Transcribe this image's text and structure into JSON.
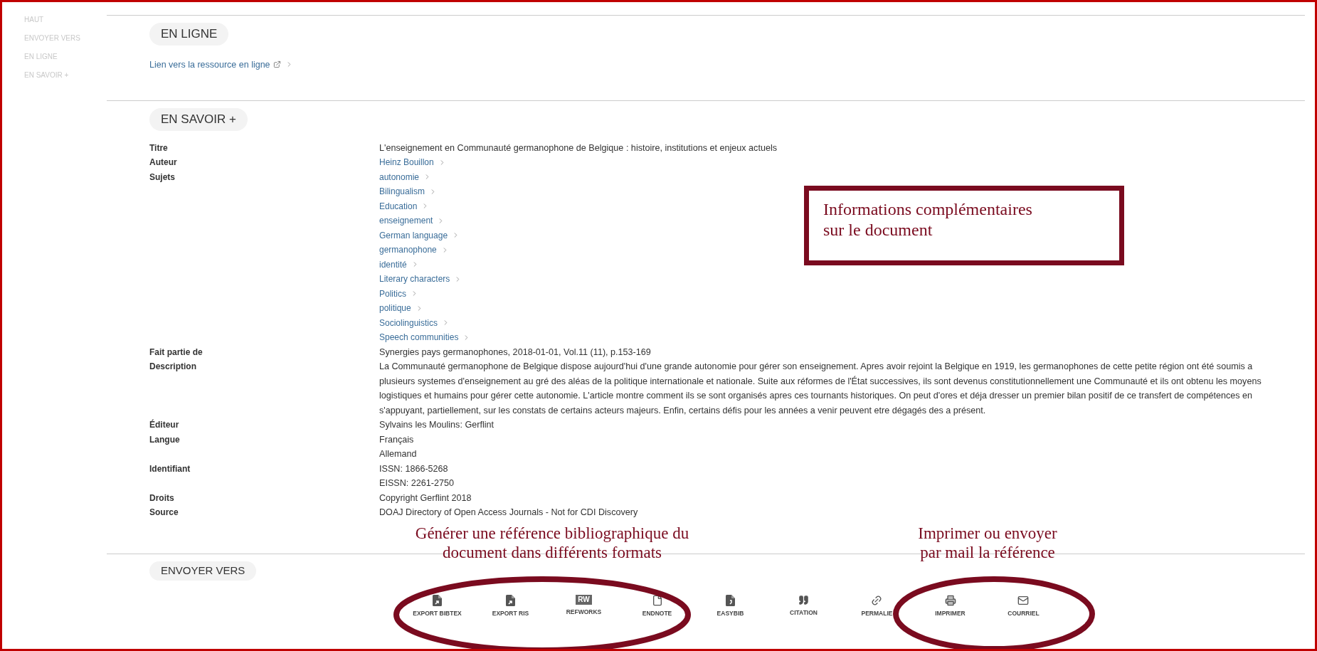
{
  "sidebar_nav": [
    "HAUT",
    "ENVOYER VERS",
    "EN LIGNE",
    "EN SAVOIR +"
  ],
  "en_ligne": {
    "heading": "EN LIGNE",
    "link": "Lien vers la ressource en ligne"
  },
  "en_savoir": {
    "heading": "EN SAVOIR +",
    "fields": [
      {
        "label": "Titre",
        "values": [
          {
            "kind": "text",
            "text": "L'enseignement en Communauté germanophone de Belgique : histoire, institutions et enjeux actuels"
          }
        ]
      },
      {
        "label": "Auteur",
        "values": [
          {
            "kind": "link",
            "text": "Heinz Bouillon"
          }
        ]
      },
      {
        "label": "Sujets",
        "values": [
          {
            "kind": "link",
            "text": "autonomie"
          },
          {
            "kind": "link",
            "text": "Bilingualism"
          },
          {
            "kind": "link",
            "text": "Education"
          },
          {
            "kind": "link",
            "text": "enseignement"
          },
          {
            "kind": "link",
            "text": "German language"
          },
          {
            "kind": "link",
            "text": "germanophone"
          },
          {
            "kind": "link",
            "text": "identité"
          },
          {
            "kind": "link",
            "text": "Literary characters"
          },
          {
            "kind": "link",
            "text": "Politics"
          },
          {
            "kind": "link",
            "text": "politique"
          },
          {
            "kind": "link",
            "text": "Sociolinguistics"
          },
          {
            "kind": "link",
            "text": "Speech communities"
          }
        ]
      },
      {
        "label": "Fait partie de",
        "values": [
          {
            "kind": "text",
            "text": "Synergies pays germanophones, 2018-01-01, Vol.11 (11), p.153-169"
          }
        ]
      },
      {
        "label": "Description",
        "values": [
          {
            "kind": "text",
            "text": "La Communauté germanophone de Belgique dispose aujourd'hui d'une grande autonomie pour gérer son enseignement. Apres avoir rejoint la Belgique en 1919, les germanophones de cette petite région ont été soumis a plusieurs systemes d'enseignement au gré des aléas de la politique internationale et nationale. Suite aux réformes de l'État successives, ils sont devenus constitutionnellement une Communauté et ils ont obtenu les moyens logistiques et humains pour gérer cette autonomie. L'article montre comment ils se sont organisés apres ces tournants historiques. On peut d'ores et déja dresser un premier bilan positif de ce transfert de compétences en s'appuyant, partiellement, sur les constats de certains acteurs majeurs. Enfin, certains défis pour les années a venir peuvent etre dégagés des a présent."
          }
        ]
      },
      {
        "label": "Éditeur",
        "values": [
          {
            "kind": "text",
            "text": "Sylvains les Moulins: Gerflint"
          }
        ]
      },
      {
        "label": "Langue",
        "values": [
          {
            "kind": "text",
            "text": "Français"
          },
          {
            "kind": "text",
            "text": "Allemand"
          }
        ]
      },
      {
        "label": "Identifiant",
        "values": [
          {
            "kind": "text",
            "text": "ISSN: 1866-5268"
          },
          {
            "kind": "text",
            "text": "EISSN: 2261-2750"
          }
        ]
      },
      {
        "label": "Droits",
        "values": [
          {
            "kind": "text",
            "text": "Copyright Gerflint 2018"
          }
        ]
      },
      {
        "label": "Source",
        "values": [
          {
            "kind": "text",
            "text": "DOAJ Directory of Open Access Journals - Not for CDI Discovery"
          }
        ]
      }
    ]
  },
  "envoyer_vers": {
    "heading": "ENVOYER VERS",
    "actions": [
      {
        "kind": "file-arrow",
        "label": "EXPORT BIBTEX"
      },
      {
        "kind": "file-arrow",
        "label": "EXPORT RIS"
      },
      {
        "kind": "badge",
        "label": "REFWORKS",
        "icon_text": "RW"
      },
      {
        "kind": "file",
        "label": "ENDNOTE"
      },
      {
        "kind": "file-mark",
        "label": "EASYBIB"
      },
      {
        "kind": "quote",
        "label": "CITATION"
      },
      {
        "kind": "link",
        "label": "PERMALIE"
      },
      {
        "kind": "print",
        "label": "IMPRIMER"
      },
      {
        "kind": "mail",
        "label": "COURRIEL"
      }
    ]
  },
  "annotations": [
    {
      "kind": "box",
      "lines": [
        "Informations complémentaires",
        "sur le document"
      ]
    },
    {
      "kind": "caption-left",
      "lines": [
        "Générer une référence bibliographique du",
        "document dans différents formats"
      ]
    },
    {
      "kind": "caption-right",
      "lines": [
        "Imprimer ou envoyer",
        "par mail la référence"
      ]
    }
  ]
}
